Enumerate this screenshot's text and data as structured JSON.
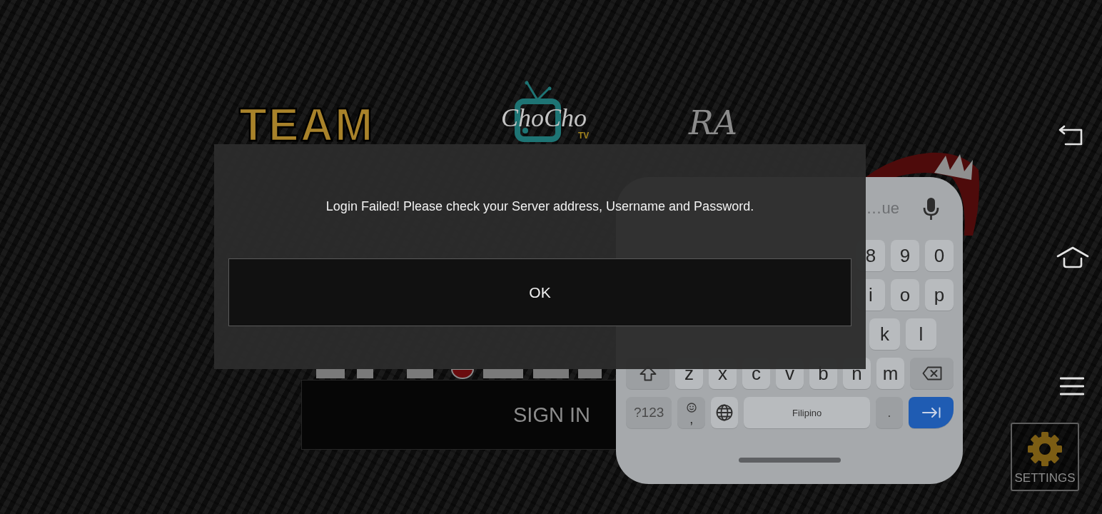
{
  "logos": [
    {
      "kind": "team",
      "text": "TEAM"
    },
    {
      "kind": "tv",
      "text": "ChoCho",
      "tag": "TV"
    },
    {
      "kind": "script",
      "text": "RA"
    }
  ],
  "sign_in_button": "SIGN IN",
  "nav": [
    {
      "kind": "back"
    },
    {
      "kind": "home"
    },
    {
      "kind": "menu"
    },
    {
      "kind": "settings",
      "label": "SETTINGS"
    }
  ],
  "keyboard": {
    "suggestion": "…ue",
    "rows": [
      {
        "keys": [
          {
            "kind": "letter",
            "label": "8"
          },
          {
            "kind": "letter",
            "label": "9"
          },
          {
            "kind": "letter",
            "label": "0"
          }
        ]
      },
      {
        "keys": [
          {
            "kind": "letter",
            "label": "i"
          },
          {
            "kind": "letter",
            "label": "o"
          },
          {
            "kind": "letter",
            "label": "p"
          }
        ]
      },
      {
        "keys": [
          {
            "kind": "letter",
            "label": "k"
          },
          {
            "kind": "letter",
            "label": "l"
          }
        ]
      },
      {
        "keys": [
          {
            "kind": "shift"
          },
          {
            "kind": "letter",
            "label": "z"
          },
          {
            "kind": "letter",
            "label": "x"
          },
          {
            "kind": "letter",
            "label": "c"
          },
          {
            "kind": "letter",
            "label": "v"
          },
          {
            "kind": "letter",
            "label": "b"
          },
          {
            "kind": "letter",
            "label": "n"
          },
          {
            "kind": "letter",
            "label": "m"
          },
          {
            "kind": "backspace"
          }
        ]
      },
      {
        "keys": [
          {
            "kind": "function",
            "label": "?123"
          },
          {
            "kind": "emoji",
            "label": ","
          },
          {
            "kind": "globe"
          },
          {
            "kind": "space",
            "label": "Filipino"
          },
          {
            "kind": "function",
            "label": "."
          },
          {
            "kind": "enter"
          }
        ]
      }
    ]
  },
  "dialog": {
    "message": "Login Failed! Please check your Server address, Username and Password.",
    "button": "OK"
  }
}
